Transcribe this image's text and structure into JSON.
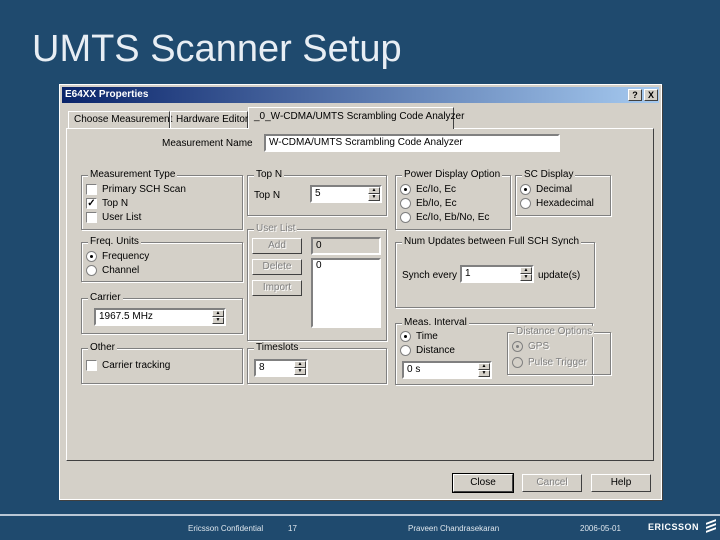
{
  "slide": {
    "title": "UMTS Scanner Setup",
    "footer": {
      "confidential": "Ericsson Confidential",
      "page": "17",
      "author": "Praveen Chandrasekaran",
      "date": "2006-05-01",
      "logo": "ERICSSON"
    }
  },
  "dialog": {
    "title": "E64XX Properties",
    "titlebar_buttons": [
      "?",
      "X"
    ],
    "tabs": [
      "Choose Measurement",
      "Hardware Editor",
      "_0_W-CDMA/UMTS Scrambling Code Analyzer"
    ],
    "active_tab": 2,
    "measurement_name": {
      "label": "Measurement Name",
      "value": "W-CDMA/UMTS Scrambling Code Analyzer"
    },
    "measurement_type": {
      "title": "Measurement Type",
      "options": [
        {
          "label": "Primary SCH Scan",
          "checked": false
        },
        {
          "label": "Top N",
          "checked": true
        },
        {
          "label": "User List",
          "checked": false
        }
      ]
    },
    "top_n": {
      "title": "Top N",
      "label": "Top N",
      "value": "5"
    },
    "user_list": {
      "title": "User List",
      "add_button": "Add",
      "delete_button": "Delete",
      "import_button": "Import",
      "count_value": "0",
      "list_value": "0"
    },
    "freq_units": {
      "title": "Freq. Units",
      "options": [
        {
          "label": "Frequency",
          "selected": true
        },
        {
          "label": "Channel",
          "selected": false
        }
      ]
    },
    "carrier": {
      "title": "Carrier",
      "value": "1967.5 MHz"
    },
    "other": {
      "title": "Other",
      "carrier_tracking": {
        "label": "Carrier tracking",
        "checked": false
      }
    },
    "timeslots": {
      "title": "Timeslots",
      "value": "8"
    },
    "power_display": {
      "title": "Power Display Option",
      "options": [
        {
          "label": "Ec/Io, Ec",
          "selected": true
        },
        {
          "label": "Eb/Io, Ec",
          "selected": false
        },
        {
          "label": "Ec/Io, Eb/No, Ec",
          "selected": false
        }
      ]
    },
    "scr_display": {
      "title": "SC Display",
      "options": [
        {
          "label": "Decimal",
          "selected": true
        },
        {
          "label": "Hexadecimal",
          "selected": false
        }
      ]
    },
    "sync": {
      "title": "Num Updates between Full SCH Synch",
      "prefix": "Synch every",
      "value": "1",
      "suffix": "update(s)"
    },
    "meas_interval": {
      "title": "Meas. Interval",
      "options": [
        {
          "label": "Time",
          "selected": true
        },
        {
          "label": "Distance",
          "selected": false
        }
      ],
      "value": "0 s"
    },
    "distance_options": {
      "title": "Distance Options",
      "options": [
        {
          "label": "GPS",
          "selected": true
        },
        {
          "label": "Pulse Trigger",
          "selected": false
        }
      ]
    },
    "buttons": {
      "close": "Close",
      "cancel": "Cancel",
      "help": "Help"
    }
  }
}
